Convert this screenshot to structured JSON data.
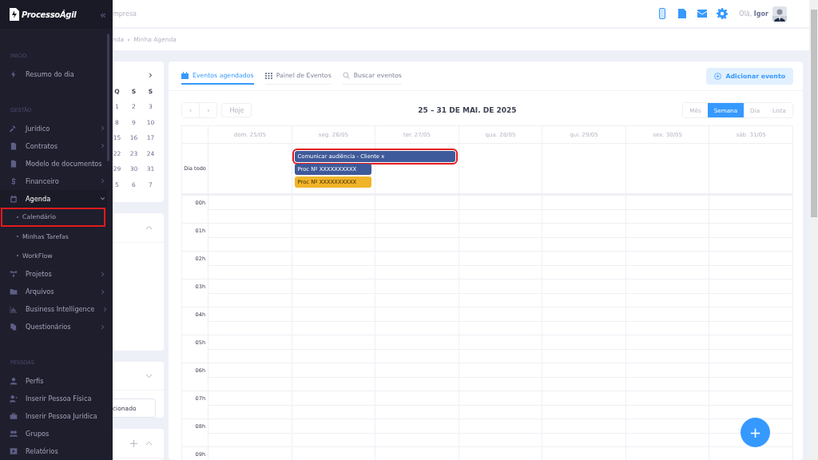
{
  "sidebar": {
    "logo": "ProcessoÁgil",
    "collapse_icon": "«",
    "sections": [
      {
        "heading": "INÍCIO",
        "items": [
          {
            "label": "Resumo do dia",
            "active": false
          }
        ]
      },
      {
        "heading": "GESTÃO",
        "items": [
          {
            "label": "Jurídico",
            "expanded": false,
            "active": false
          },
          {
            "label": "Contratos",
            "expanded": false,
            "active": false
          },
          {
            "label": "Modelo de documentos",
            "expanded": false,
            "active": false
          },
          {
            "label": "Financeiro",
            "expanded": false,
            "active": false
          },
          {
            "label": "Agenda",
            "expanded": true,
            "active": true,
            "children": [
              {
                "label": "Calendário",
                "highlighted": true
              },
              {
                "label": "Minhas Tarefas",
                "highlighted": false
              },
              {
                "label": "WorkFlow",
                "highlighted": false
              }
            ]
          },
          {
            "label": "Projetos",
            "expanded": false,
            "active": false
          },
          {
            "label": "Arquivos",
            "expanded": false,
            "active": false
          },
          {
            "label": "Business Intelligence",
            "expanded": false,
            "active": false
          },
          {
            "label": "Questionários",
            "expanded": false,
            "active": false
          }
        ]
      },
      {
        "heading": "PESSOAS",
        "items": [
          {
            "label": "Perfis",
            "active": false
          },
          {
            "label": "Inserir Pessoa Física",
            "active": false
          },
          {
            "label": "Inserir Pessoa Jurídica",
            "active": false
          },
          {
            "label": "Grupos",
            "active": false
          },
          {
            "label": "Relatórios",
            "active": false
          }
        ]
      }
    ]
  },
  "topbar": {
    "company": "mpresa",
    "greeting": "Olá,",
    "user": "Igor"
  },
  "breadcrumb": [
    "nda",
    "Minha Agenda"
  ],
  "mini_calendar": {
    "next": "›",
    "weekdays": [
      "Q",
      "S",
      "S"
    ],
    "weeks": [
      [
        "1",
        "2",
        "3"
      ],
      [
        "8",
        "9",
        "10"
      ],
      [
        "15",
        "16",
        "17"
      ],
      [
        "22",
        "23",
        "24"
      ],
      [
        "29",
        "30",
        "31"
      ],
      [
        "5",
        "6",
        "7"
      ]
    ]
  },
  "filter_field": {
    "value": "cionado"
  },
  "tabs": [
    {
      "label": "Eventos agendados",
      "selected": true
    },
    {
      "label": "Painel de Eventos",
      "selected": false
    },
    {
      "label": "Buscar eventos",
      "selected": false
    }
  ],
  "add_button": "Adicionar evento",
  "toolbar": {
    "prev": "‹",
    "next": "›",
    "today": "Hoje",
    "title": "25 – 31 DE MAI. DE 2025",
    "views": [
      {
        "label": "Mês",
        "selected": false
      },
      {
        "label": "Semana",
        "selected": true
      },
      {
        "label": "Dia",
        "selected": false
      },
      {
        "label": "Lista",
        "selected": false
      }
    ]
  },
  "week": {
    "all_day_label": "Dia todo",
    "days": [
      {
        "label": "dom. 25/05"
      },
      {
        "label": "seg. 26/05",
        "events": [
          {
            "title": "Comunicar audiência - Cliente x",
            "continues_next_day": true,
            "color": "#3f5a9a",
            "highlighted": true
          },
          {
            "title": "Proc Nº XXXXXXXXXX",
            "continues_next_day": false,
            "color": "#3f5a9a",
            "highlighted": false
          },
          {
            "title": "Proc Nº XXXXXXXXXX",
            "continues_next_day": false,
            "color": "#f0b429",
            "highlighted": false
          }
        ]
      },
      {
        "label": "ter. 27/05"
      },
      {
        "label": "qua. 28/05"
      },
      {
        "label": "qui. 29/05"
      },
      {
        "label": "sex. 30/05"
      },
      {
        "label": "sáb. 31/05"
      }
    ],
    "hours": [
      "00h",
      "01h",
      "02h",
      "03h",
      "04h",
      "05h",
      "06h",
      "07h",
      "08h",
      "09h"
    ]
  },
  "fab": "+"
}
